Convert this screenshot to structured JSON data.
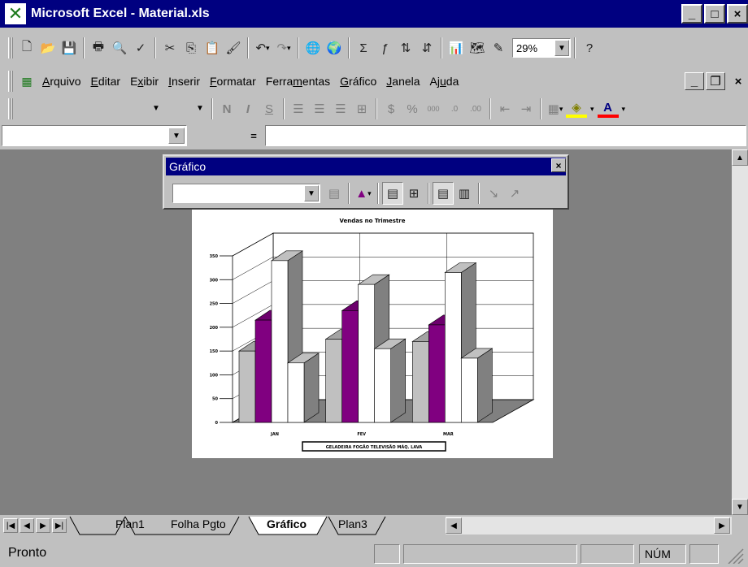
{
  "window": {
    "title": "Microsoft Excel - Material.xls",
    "minimize": "_",
    "maximize": "□",
    "close": "×"
  },
  "standard_toolbar": {
    "icons": [
      "new-icon",
      "open-icon",
      "save-icon",
      "print-icon",
      "print-preview-icon",
      "spelling-icon",
      "cut-icon",
      "copy-icon",
      "paste-icon",
      "format-painter-icon",
      "undo-icon",
      "redo-icon",
      "hyperlink-icon",
      "web-toolbar-icon",
      "autosum-icon",
      "paste-function-icon",
      "sort-ascending-icon",
      "sort-descending-icon",
      "chart-wizard-icon",
      "map-icon",
      "drawing-icon",
      "help-icon"
    ],
    "zoom": "29%"
  },
  "menubar": {
    "items": [
      {
        "label": "Arquivo",
        "key": "A"
      },
      {
        "label": "Editar",
        "key": "E"
      },
      {
        "label": "Exibir",
        "key": "x"
      },
      {
        "label": "Inserir",
        "key": "I"
      },
      {
        "label": "Formatar",
        "key": "F"
      },
      {
        "label": "Ferramentas",
        "key": "m"
      },
      {
        "label": "Gráfico",
        "key": "G"
      },
      {
        "label": "Janela",
        "key": "J"
      },
      {
        "label": "Ajuda",
        "key": "u"
      }
    ]
  },
  "formatting_toolbar": {
    "font_name": "",
    "font_size": "",
    "bold": "N",
    "italic": "I",
    "underline": "S"
  },
  "formula_bar": {
    "name_box": "",
    "equals": "=",
    "formula": ""
  },
  "chart_toolbar": {
    "title": "Gráfico",
    "close": "×",
    "object_value": ""
  },
  "chart_data": {
    "type": "bar",
    "title": "Vendas no Trimestre",
    "categories": [
      "JAN",
      "FEV",
      "MAR"
    ],
    "series": [
      {
        "name": "GELADEIRA",
        "values": [
          150,
          175,
          170
        ],
        "color": "#c0c0c0"
      },
      {
        "name": "FOGÃO",
        "values": [
          215,
          235,
          205
        ],
        "color": "#800080"
      },
      {
        "name": "TELEVISÃO",
        "values": [
          340,
          290,
          315
        ],
        "color": "#ffffff"
      },
      {
        "name": "MÁQ. LAVAR",
        "values": [
          125,
          155,
          135
        ],
        "color": "#ffffff"
      }
    ],
    "y_ticks": [
      "0",
      "50",
      "100",
      "150",
      "200",
      "250",
      "300",
      "350"
    ],
    "ylim": [
      0,
      350
    ],
    "grid": true,
    "legend": "bottom",
    "legend_text": "GELADEIRA FOGÃO TELEVISÃO MÁQ. LAVA"
  },
  "sheet_tabs": {
    "tabs": [
      "Plan1",
      "Folha Pgto",
      "Gráfico",
      "Plan3"
    ],
    "active": "Gráfico"
  },
  "status_bar": {
    "text": "Pronto",
    "num": "NÚM"
  }
}
